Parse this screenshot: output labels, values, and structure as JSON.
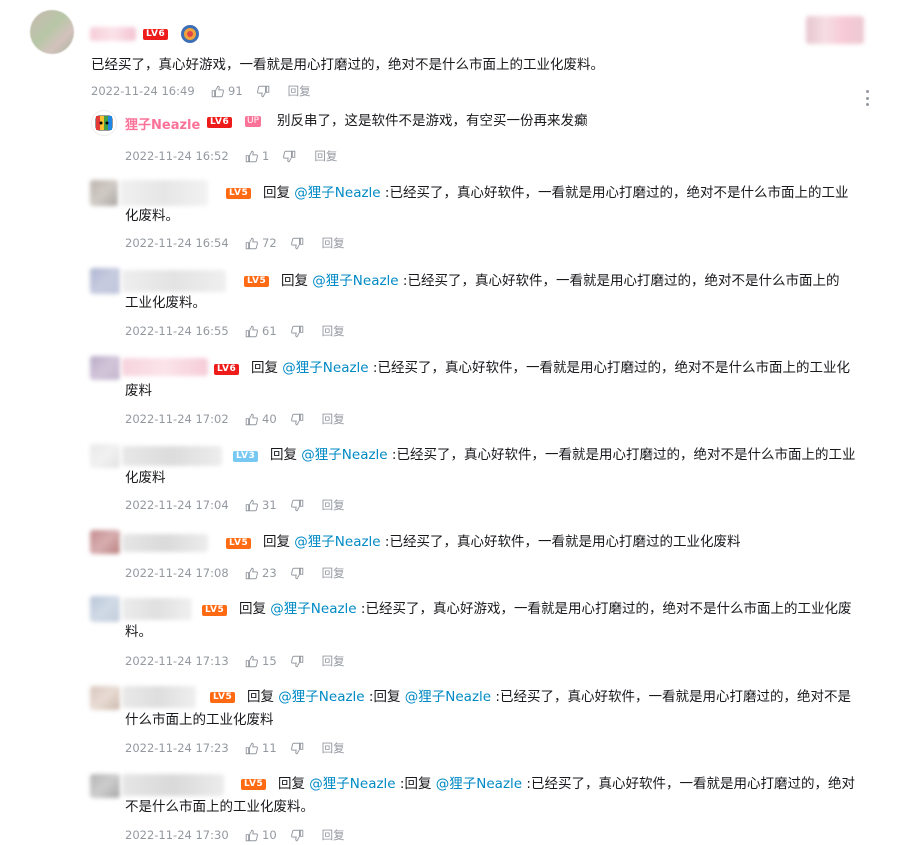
{
  "main_comment": {
    "level": "LV6",
    "text": "已经买了，真心好游戏，一看就是用心打磨过的，绝对不是什么市面上的工业化废料。",
    "time": "2022-11-24 16:49",
    "likes": "91",
    "reply_label": "回复"
  },
  "up_reply": {
    "name": "狸子Neazle",
    "level": "LV6",
    "up_label": "UP",
    "text": "别反串了，这是软件不是游戏，有空买一份再来发癫",
    "time": "2022-11-24 16:52",
    "likes": "1",
    "reply_label": "回复"
  },
  "replies": [
    {
      "level": "LV5",
      "prefix": "回复",
      "at": "@狸子Neazle",
      "line1": ":已经买了，真心好软件，一看就是用心打磨过的，绝对不是什么市面上的工业",
      "line2": "化废料。",
      "time": "2022-11-24 16:54",
      "likes": "72",
      "reply_label": "回复"
    },
    {
      "level": "LV5",
      "prefix": "回复",
      "at": "@狸子Neazle",
      "line1": ":已经买了，真心好软件，一看就是用心打磨过的，绝对不是什么市面上的",
      "line2": "工业化废料。",
      "time": "2022-11-24 16:55",
      "likes": "61",
      "reply_label": "回复"
    },
    {
      "level": "LV6",
      "prefix": "回复",
      "at": "@狸子Neazle",
      "line1": ":已经买了，真心好软件，一看就是用心打磨过的，绝对不是什么市面上的工业化",
      "line2": "废料",
      "time": "2022-11-24 17:02",
      "likes": "40",
      "reply_label": "回复"
    },
    {
      "level": "LV3",
      "prefix": "回复",
      "at": "@狸子Neazle",
      "line1": ":已经买了，真心好软件，一看就是用心打磨过的，绝对不是什么市面上的工业",
      "line2": "化废料",
      "time": "2022-11-24 17:04",
      "likes": "31",
      "reply_label": "回复"
    },
    {
      "level": "LV5",
      "prefix": "回复",
      "at": "@狸子Neazle",
      "line1": ":已经买了，真心好软件，一看就是用心打磨过的工业化废料",
      "line2": "",
      "time": "2022-11-24 17:08",
      "likes": "23",
      "reply_label": "回复"
    },
    {
      "level": "LV5",
      "prefix": "回复",
      "at": "@狸子Neazle",
      "line1": ":已经买了，真心好游戏，一看就是用心打磨过的，绝对不是什么市面上的工业化废",
      "line2": "料。",
      "time": "2022-11-24 17:13",
      "likes": "15",
      "reply_label": "回复"
    },
    {
      "level": "LV5",
      "prefix": "回复",
      "at": "@狸子Neazle",
      "mid": ":回复",
      "at2": "@狸子Neazle",
      "line1": ":已经买了，真心好软件，一看就是用心打磨过的，绝对不是",
      "line2": "什么市面上的工业化废料",
      "time": "2022-11-24 17:23",
      "likes": "11",
      "reply_label": "回复"
    },
    {
      "level": "LV5",
      "prefix": "回复",
      "at": "@狸子Neazle",
      "mid": ":回复",
      "at2": "@狸子Neazle",
      "line1": ":已经买了，真心好软件，一看就是用心打磨过的，绝对",
      "line2": "不是什么市面上的工业化废料。",
      "time": "2022-11-24 17:30",
      "likes": "10",
      "reply_label": "回复"
    }
  ],
  "icons": {
    "like": "thumb-up-icon",
    "dislike": "thumb-down-icon",
    "more": "more-vertical-icon"
  },
  "colors": {
    "mention": "#008ac5",
    "up_name": "#fb7299",
    "meta": "#9499a0"
  }
}
